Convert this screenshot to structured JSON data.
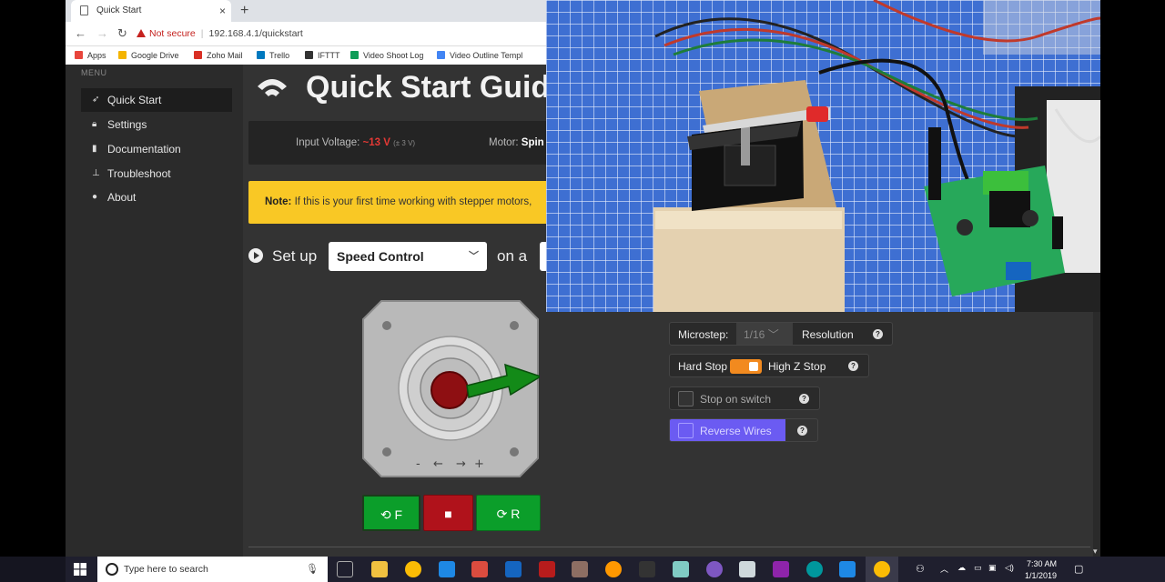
{
  "browser": {
    "tab_title": "Quick Start",
    "tab_close": "×",
    "new_tab": "+",
    "security_warning": "Not secure",
    "url": "192.168.4.1/quickstart",
    "bookmarks": [
      "Apps",
      "Google Drive",
      "Zoho Mail",
      "Trello",
      "IFTTT",
      "Video Shoot Log",
      "Video Outline Templ"
    ]
  },
  "sidebar": {
    "menu_label": "MENU",
    "items": [
      {
        "label": "Quick Start",
        "icon": "rocket-icon",
        "active": true
      },
      {
        "label": "Settings",
        "icon": "lock-icon"
      },
      {
        "label": "Documentation",
        "icon": "book-icon"
      },
      {
        "label": "Troubleshoot",
        "icon": "pin-icon"
      },
      {
        "label": "About",
        "icon": "info-icon"
      }
    ]
  },
  "main": {
    "title": "Quick Start Guid",
    "status": {
      "voltage_label": "Input Voltage:",
      "voltage_value": "~13 V",
      "voltage_tolerance": "(± 3 V)",
      "motor_label": "Motor:",
      "motor_value": "Spin"
    },
    "note": {
      "bold": "Note:",
      "text": " If this is your first time working with stepper motors,"
    },
    "setup": {
      "label": "Set up",
      "mode": "Speed Control",
      "on_a": "on a"
    },
    "motor_controls": {
      "minus": "-",
      "left": "←",
      "right": "→",
      "plus": "+"
    },
    "buttons": {
      "forward": "F",
      "stop": "■",
      "reverse": "R"
    },
    "settings": {
      "microstep_label": "Microstep:",
      "microstep_value": "1/16",
      "resolution_label": "Resolution",
      "hard_stop_label": "Hard Stop",
      "high_z_label": "High Z Stop",
      "stop_on_switch_label": "Stop on switch",
      "reverse_wires_label": "Reverse Wires",
      "help": "?"
    }
  },
  "taskbar": {
    "search_placeholder": "Type here to search",
    "time": "7:30 AM",
    "date": "1/1/2019"
  },
  "colors": {
    "accent_green": "#0b9e2a",
    "stop_red": "#b0121b",
    "note_yellow": "#f9c825",
    "toggle_orange": "#f28a1f",
    "reverse_purple": "#6b5bf2"
  }
}
